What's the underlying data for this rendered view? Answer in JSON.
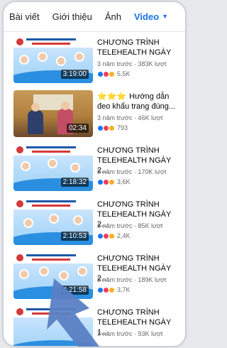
{
  "tabs": [
    "Bài viết",
    "Giới thiệu",
    "Ảnh",
    "Video"
  ],
  "active_tab_caret": "▼",
  "videos": [
    {
      "title": "CHƯƠNG TRÌNH TELEHEALTH NGÀY",
      "duration": "3:19:00",
      "meta": "3 năm trước · 383K lượt",
      "reactions": "5,5K",
      "thumb": "blue"
    },
    {
      "title": "Hướng dẫn đeo khẩu trang đúng...",
      "title_prefix": "⭐⭐⭐",
      "duration": "02:34",
      "meta": "3 năm trước · 46K lượt",
      "reactions": "793",
      "thumb": "room"
    },
    {
      "title": "CHƯƠNG TRÌNH TELEHEALTH NGÀY 2...",
      "duration": "2:18:32",
      "meta": "3 năm trước · 170K lượt",
      "reactions": "3,6K",
      "thumb": "blue"
    },
    {
      "title": "CHƯƠNG TRÌNH TELEHEALTH NGÀY 2...",
      "duration": "2:10:53",
      "meta": "3 năm trước · 85K lượt",
      "reactions": "2,4K",
      "thumb": "blue"
    },
    {
      "title": "CHƯƠNG TRÌNH TELEHEALTH NGÀY 2...",
      "duration": "4:21:58",
      "meta": "3 năm trước · 189K lượt",
      "reactions": "3,7K",
      "thumb": "blue"
    },
    {
      "title": "CHƯƠNG TRÌNH TELEHEALTH NGÀY 1...",
      "duration": "",
      "meta": "3 năm trước · 93K lượt",
      "reactions": "",
      "thumb": "blue"
    }
  ],
  "colors": {
    "accent": "#1b74e4",
    "pointer": "#5a7fc4"
  }
}
